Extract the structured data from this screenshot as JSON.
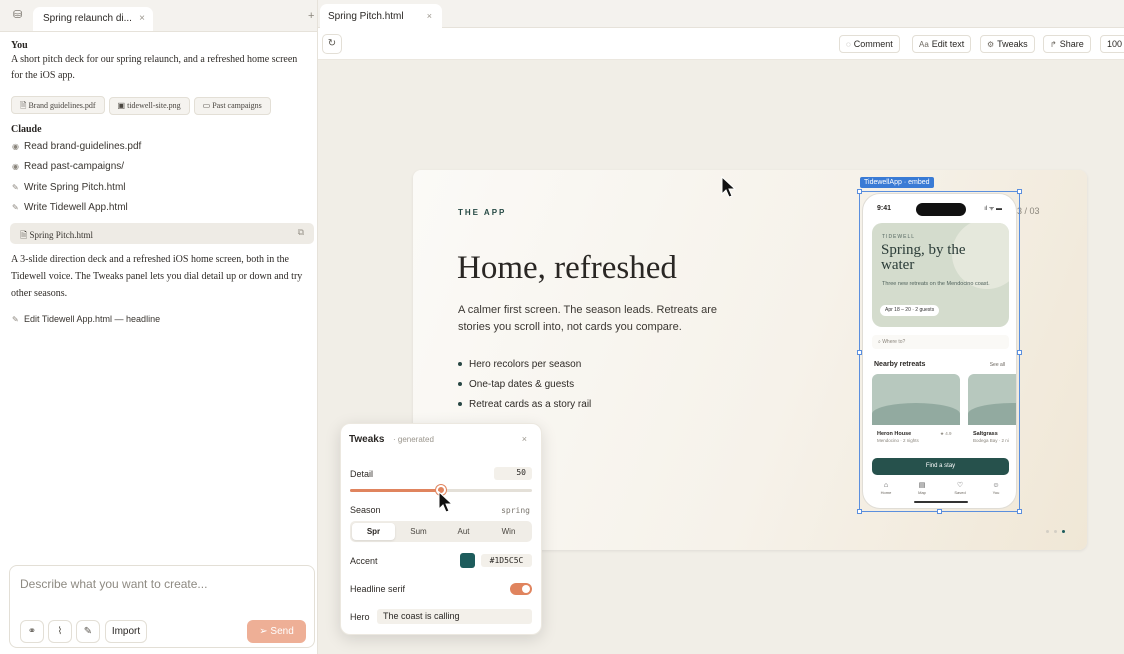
{
  "left_tab": {
    "title": "Spring relaunch di...",
    "close": "×"
  },
  "new_tab": "+",
  "chat": {
    "user_name": "You",
    "user_message": "A short pitch deck for our spring relaunch, and a refreshed home screen for the iOS app.",
    "attachments": [
      "Brand guidelines.pdf",
      "tidewell-site.png",
      "Past campaigns"
    ],
    "assistant_name": "Claude",
    "actions": [
      "Read brand-guidelines.pdf",
      "Read past-campaigns/",
      "Write Spring Pitch.html",
      "Write Tidewell App.html"
    ],
    "file_card": "Spring Pitch.html",
    "assistant_message": "A 3-slide direction deck and a refreshed iOS home screen, both in the Tidewell voice. The Tweaks panel lets you dial detail up or down and try other seasons.",
    "edit_action": "Edit Tidewell App.html — headline"
  },
  "composer": {
    "placeholder": "Describe what you want to create...",
    "import_label": "Import",
    "send_label": "Send"
  },
  "main_tab": {
    "title": "Spring Pitch.html",
    "close": "×"
  },
  "toolbar": {
    "comment": "Comment",
    "edit_text": "Edit text",
    "tweaks": "Tweaks",
    "share": "Share",
    "zoom": "100"
  },
  "slide": {
    "eyebrow": "THE APP",
    "headline": "Home, refreshed",
    "sub": "A calmer first screen. The season leads. Retreats are stories you scroll into, not cards you compare.",
    "bullets": [
      "Hero recolors per season",
      "One-tap dates & guests",
      "Retreat cards as a story rail"
    ],
    "page": "3 / 03",
    "active_dot": 3
  },
  "phone": {
    "embed_label": "TidewellApp · embed",
    "time": "9:41",
    "brand": "TIDEWELL",
    "hero_title": "Spring, by the water",
    "hero_desc": "Three new retreats on the Mendocino coast.",
    "pill": "Apr 18 – 20  ·  2 guests",
    "search": "Where to?",
    "nearby": "Nearby retreats",
    "see_all": "See all",
    "cards": [
      {
        "name": "Heron House",
        "location": "Mendocino · 2 nights",
        "rating": "★ 4.9"
      },
      {
        "name": "Saltgrass",
        "location": "Bodega Bay · 2 ni"
      }
    ],
    "cta": "Find a stay",
    "nav": [
      "Home",
      "Map",
      "Saved",
      "You"
    ]
  },
  "tweaks": {
    "title": "Tweaks",
    "generated": "· generated",
    "close": "×",
    "detail_label": "Detail",
    "detail_value": "50",
    "detail_fraction": 0.5,
    "season_label": "Season",
    "season_value": "spring",
    "seasons": [
      "Spr",
      "Sum",
      "Aut",
      "Win"
    ],
    "accent_label": "Accent",
    "accent_hex": "#1D5C5C",
    "headline_serif_label": "Headline serif",
    "headline_serif_on": true,
    "hero_label": "Hero",
    "hero_value": "The coast is calling"
  },
  "colors": {
    "accent": "#1d5c5c",
    "orange": "#e0845e",
    "send": "#eeaf96"
  }
}
